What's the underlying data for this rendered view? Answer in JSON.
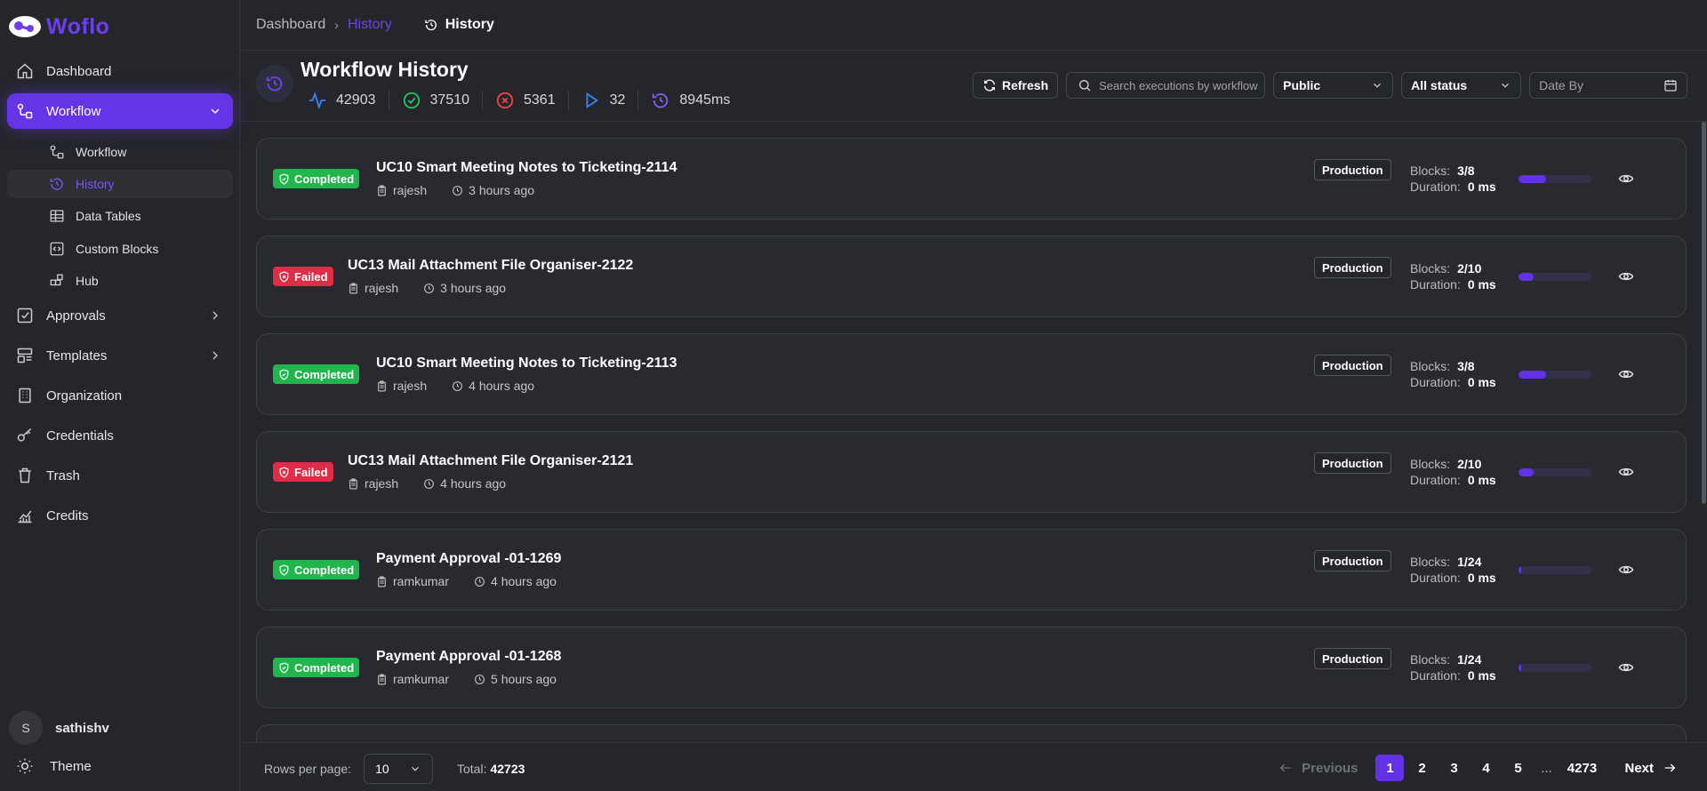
{
  "app": {
    "logo_text": "Woflo",
    "accent": "#6434e6"
  },
  "sidebar": {
    "items": [
      {
        "label": "Dashboard",
        "icon": "home-icon"
      },
      {
        "label": "Workflow",
        "icon": "workflow-icon",
        "active": true
      },
      {
        "label": "Approvals",
        "icon": "checkbox-icon"
      },
      {
        "label": "Templates",
        "icon": "template-icon"
      },
      {
        "label": "Organization",
        "icon": "building-icon"
      },
      {
        "label": "Credentials",
        "icon": "key-icon"
      },
      {
        "label": "Trash",
        "icon": "trash-icon"
      },
      {
        "label": "Credits",
        "icon": "chart-icon"
      }
    ],
    "sub_items": [
      {
        "label": "Workflow",
        "icon": "workflow-icon"
      },
      {
        "label": "History",
        "icon": "history-icon",
        "active": true
      },
      {
        "label": "Data Tables",
        "icon": "table-icon"
      },
      {
        "label": "Custom Blocks",
        "icon": "code-icon"
      },
      {
        "label": "Hub",
        "icon": "blocks-icon"
      }
    ],
    "user": {
      "initial": "S",
      "name": "sathishv"
    },
    "theme_label": "Theme"
  },
  "breadcrumb": {
    "root": "Dashboard",
    "link": "History",
    "current": "History"
  },
  "header": {
    "title": "Workflow History",
    "stats": {
      "total": "42903",
      "completed": "37510",
      "failed": "5361",
      "running": "32",
      "avg_duration": "8945ms"
    },
    "refresh_label": "Refresh",
    "search_placeholder": "Search executions by workflow",
    "visibility": "Public",
    "status": "All status",
    "date_placeholder": "Date By"
  },
  "executions": [
    {
      "status": "Completed",
      "title": "UC10 Smart Meeting Notes to Ticketing-2114",
      "user": "rajesh",
      "time": "3 hours ago",
      "env": "Production",
      "blocks": "3/8",
      "duration": "0 ms",
      "progress": 0.375
    },
    {
      "status": "Failed",
      "title": "UC13 Mail Attachment File Organiser-2122",
      "user": "rajesh",
      "time": "3 hours ago",
      "env": "Production",
      "blocks": "2/10",
      "duration": "0 ms",
      "progress": 0.2
    },
    {
      "status": "Completed",
      "title": "UC10 Smart Meeting Notes to Ticketing-2113",
      "user": "rajesh",
      "time": "4 hours ago",
      "env": "Production",
      "blocks": "3/8",
      "duration": "0 ms",
      "progress": 0.375
    },
    {
      "status": "Failed",
      "title": "UC13 Mail Attachment File Organiser-2121",
      "user": "rajesh",
      "time": "4 hours ago",
      "env": "Production",
      "blocks": "2/10",
      "duration": "0 ms",
      "progress": 0.2
    },
    {
      "status": "Completed",
      "title": "Payment Approval -01-1269",
      "user": "ramkumar",
      "time": "4 hours ago",
      "env": "Production",
      "blocks": "1/24",
      "duration": "0 ms",
      "progress": 0.042
    },
    {
      "status": "Completed",
      "title": "Payment Approval -01-1268",
      "user": "ramkumar",
      "time": "5 hours ago",
      "env": "Production",
      "blocks": "1/24",
      "duration": "0 ms",
      "progress": 0.042
    }
  ],
  "labels": {
    "blocks": "Blocks:",
    "duration": "Duration:"
  },
  "footer": {
    "rows_label": "Rows per page:",
    "rows_value": "10",
    "total_label": "Total:",
    "total_value": "42723",
    "prev_label": "Previous",
    "next_label": "Next",
    "pages": [
      "1",
      "2",
      "3",
      "4",
      "5"
    ],
    "dots": "...",
    "last_page": "4273",
    "current_page": "1"
  }
}
